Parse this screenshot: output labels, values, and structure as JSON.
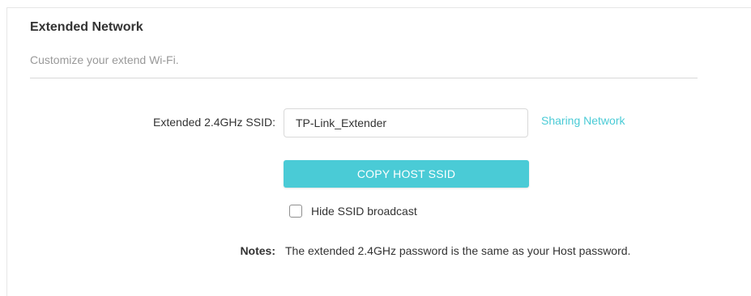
{
  "section": {
    "title": "Extended Network",
    "subtitle": "Customize your extend Wi-Fi."
  },
  "ssid": {
    "label": "Extended 2.4GHz SSID:",
    "value": "TP-Link_Extender",
    "sharing_link": "Sharing Network"
  },
  "copy_button": {
    "label": "COPY HOST SSID"
  },
  "hide_ssid": {
    "label": "Hide SSID broadcast",
    "checked": false
  },
  "notes": {
    "label": "Notes:",
    "text": "The extended 2.4GHz password is the same as your Host password."
  },
  "colors": {
    "accent": "#4acbd6",
    "text": "#333333",
    "muted": "#999999",
    "divider": "#d9d9d9"
  }
}
